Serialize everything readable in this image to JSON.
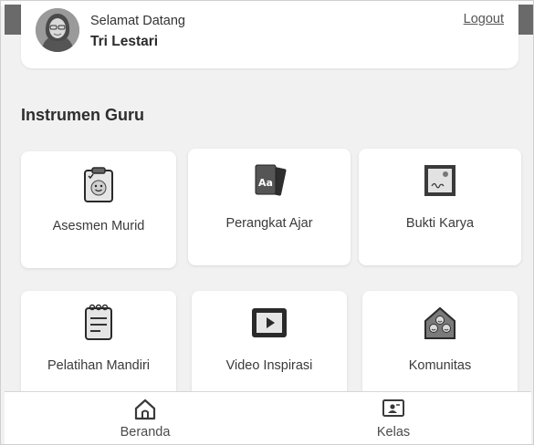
{
  "header": {
    "greeting": "Selamat Datang",
    "user_name": "Tri Lestari",
    "logout_label": "Logout"
  },
  "section": {
    "title": "Instrumen Guru"
  },
  "tiles": [
    {
      "label": "Asesmen Murid",
      "icon": "clipboard-smile-icon"
    },
    {
      "label": "Perangkat Ajar",
      "icon": "cards-aa-icon"
    },
    {
      "label": "Bukti Karya",
      "icon": "framed-certificate-icon"
    },
    {
      "label": "Pelatihan Mandiri",
      "icon": "notepad-icon"
    },
    {
      "label": "Video Inspirasi",
      "icon": "video-play-icon"
    },
    {
      "label": "Komunitas",
      "icon": "community-house-icon"
    }
  ],
  "bottom_nav": {
    "items": [
      {
        "label": "Beranda",
        "icon": "home-icon"
      },
      {
        "label": "Kelas",
        "icon": "class-board-icon"
      }
    ]
  }
}
